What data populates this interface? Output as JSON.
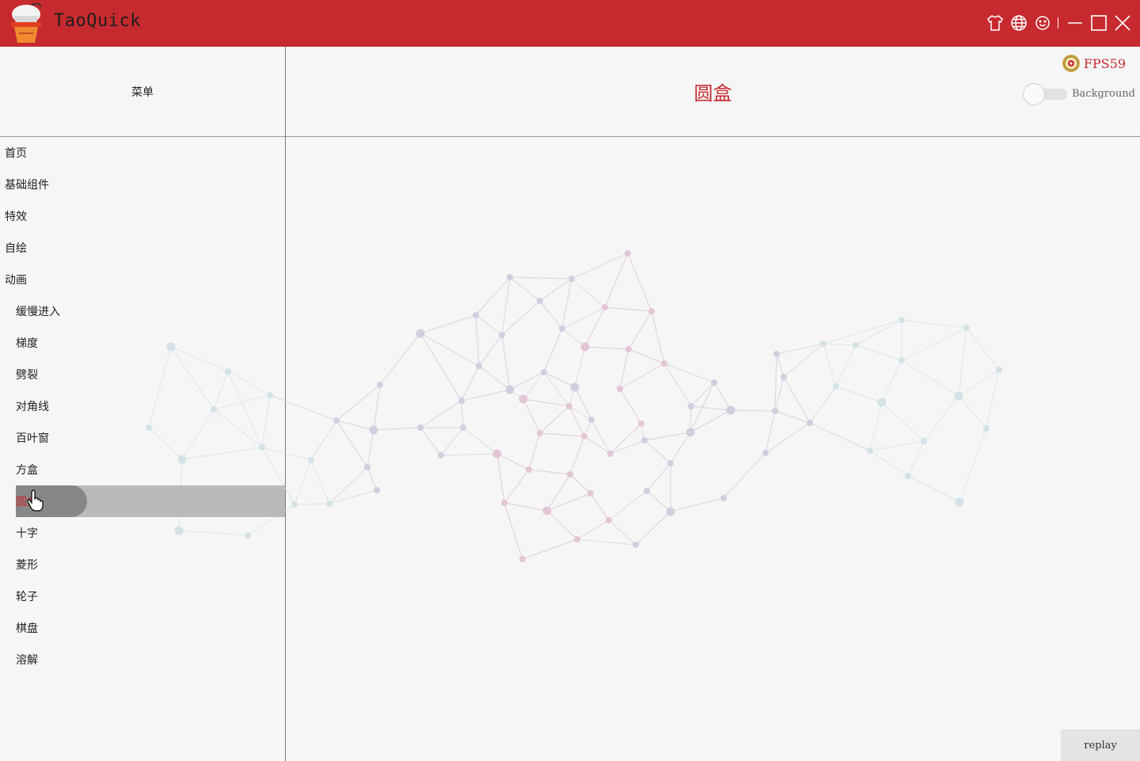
{
  "app": {
    "title": "TaoQuick"
  },
  "titlebar": {
    "icons": [
      "skin-shirt-icon",
      "language-globe-icon",
      "about-smile-icon",
      "minimize-icon",
      "maximize-icon",
      "close-icon"
    ]
  },
  "menu": {
    "header": "菜单",
    "items": [
      {
        "label": "首页",
        "indent": false
      },
      {
        "label": "基础组件",
        "indent": false
      },
      {
        "label": "特效",
        "indent": false
      },
      {
        "label": "自绘",
        "indent": false
      },
      {
        "label": "动画",
        "indent": false
      },
      {
        "label": "缓慢进入",
        "indent": true
      },
      {
        "label": "梯度",
        "indent": true
      },
      {
        "label": "劈裂",
        "indent": true
      },
      {
        "label": "对角线",
        "indent": true
      },
      {
        "label": "百叶窗",
        "indent": true
      },
      {
        "label": "方盒",
        "indent": true
      },
      {
        "label": "圆盒",
        "indent": true,
        "active": true
      },
      {
        "label": "十字",
        "indent": true
      },
      {
        "label": "菱形",
        "indent": true
      },
      {
        "label": "轮子",
        "indent": true
      },
      {
        "label": "棋盘",
        "indent": true
      },
      {
        "label": "溶解",
        "indent": true
      }
    ]
  },
  "content": {
    "title": "圆盒",
    "fps": "FPS59",
    "background_toggle_label": "Background",
    "background_toggle_on": false,
    "replay_label": "replay"
  },
  "colors": {
    "titlebar": "#c62a2f",
    "accent": "#c62a2f",
    "highlight": "#bababa"
  }
}
